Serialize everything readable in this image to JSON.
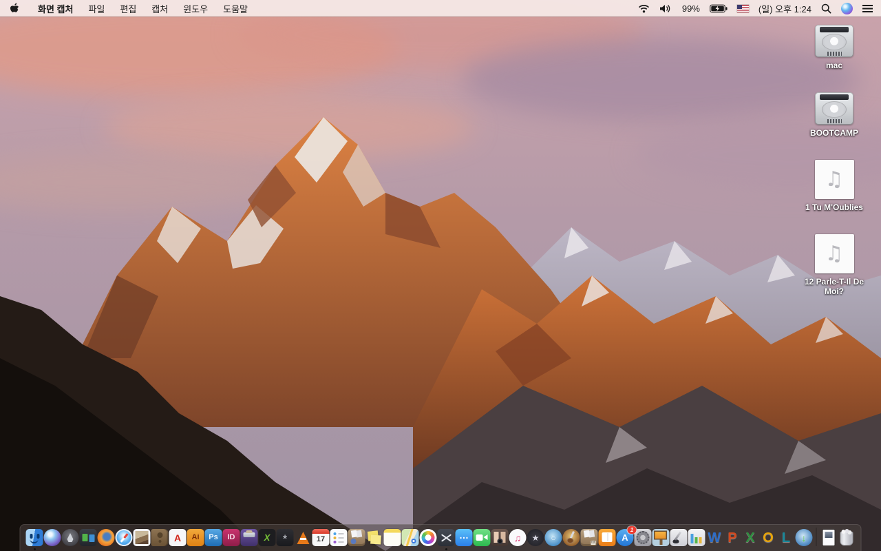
{
  "menu_bar": {
    "app_name": "화면 캡처",
    "menus": [
      "파일",
      "편집",
      "캡처",
      "윈도우",
      "도움말"
    ],
    "status": {
      "wifi_icon": "wifi-icon",
      "volume_icon": "volume-icon",
      "battery_percent": "99%",
      "battery_state": "charging",
      "input_source": "us-flag",
      "clock": "(일) 오후 1:24",
      "search_icon": "spotlight-search-icon",
      "siri_icon": "siri-icon",
      "notification_icon": "notification-center-icon"
    }
  },
  "desktop": {
    "icons": [
      {
        "name": "volume-mac",
        "kind": "harddrive",
        "label": "mac"
      },
      {
        "name": "volume-bootcamp",
        "kind": "harddrive",
        "label": "BOOTCAMP"
      },
      {
        "name": "audio-file-1",
        "kind": "audio",
        "label": "1 Tu M'Oublies"
      },
      {
        "name": "audio-file-2",
        "kind": "audio",
        "label": "12 Parle-T-Il De Moi?"
      }
    ]
  },
  "dock": {
    "items": [
      {
        "name": "finder",
        "kind": "finder",
        "running": true
      },
      {
        "name": "siri",
        "kind": "siri"
      },
      {
        "name": "launchpad",
        "kind": "launchpad"
      },
      {
        "name": "mission-control",
        "kind": "mc"
      },
      {
        "name": "firefox",
        "kind": "firefox"
      },
      {
        "name": "safari",
        "kind": "safari"
      },
      {
        "name": "preview",
        "kind": "preview"
      },
      {
        "name": "contacts",
        "kind": "contacts"
      },
      {
        "name": "acrobat-reader",
        "kind": "acrobat",
        "glyph": "A"
      },
      {
        "name": "illustrator",
        "kind": "ai",
        "glyph": "Ai"
      },
      {
        "name": "photoshop",
        "kind": "ps",
        "glyph": "Ps"
      },
      {
        "name": "indesign",
        "kind": "id",
        "glyph": "ID"
      },
      {
        "name": "toast-titanium",
        "kind": "toast"
      },
      {
        "name": "xee",
        "kind": "xee",
        "glyph": "X"
      },
      {
        "name": "fan-utility",
        "kind": "fan",
        "glyph": "*"
      },
      {
        "name": "vlc",
        "kind": "vlc"
      },
      {
        "name": "calendar",
        "kind": "calendar",
        "glyph": "17"
      },
      {
        "name": "reminders",
        "kind": "reminders"
      },
      {
        "name": "archive-box",
        "kind": "crate"
      },
      {
        "name": "stickies",
        "kind": "stickies"
      },
      {
        "name": "notes",
        "kind": "notes"
      },
      {
        "name": "maps",
        "kind": "maps"
      },
      {
        "name": "photos",
        "kind": "photos"
      },
      {
        "name": "screen-capture-grab",
        "kind": "grab",
        "running": true
      },
      {
        "name": "messages",
        "kind": "messages",
        "glyph": "…"
      },
      {
        "name": "facetime",
        "kind": "facetime"
      },
      {
        "name": "photo-booth",
        "kind": "photobooth"
      },
      {
        "name": "itunes",
        "kind": "itunes",
        "glyph": "♫"
      },
      {
        "name": "imovie",
        "kind": "imovie",
        "glyph": "★"
      },
      {
        "name": "idvd",
        "kind": "idvd",
        "glyph": "○"
      },
      {
        "name": "garageband",
        "kind": "garageband"
      },
      {
        "name": "unarchiver",
        "kind": "crate2"
      },
      {
        "name": "ibooks",
        "kind": "ibooks"
      },
      {
        "name": "app-store",
        "kind": "appstore",
        "glyph": "A",
        "badge": "1"
      },
      {
        "name": "system-preferences",
        "kind": "sysprefs"
      },
      {
        "name": "keynote",
        "kind": "keynote"
      },
      {
        "name": "pages",
        "kind": "pages"
      },
      {
        "name": "numbers",
        "kind": "numbers"
      },
      {
        "name": "word",
        "kind": "word",
        "glyph": "W"
      },
      {
        "name": "powerpoint",
        "kind": "powerpoint",
        "glyph": "P"
      },
      {
        "name": "excel",
        "kind": "excel",
        "glyph": "X"
      },
      {
        "name": "outlook",
        "kind": "outlook",
        "glyph": "O"
      },
      {
        "name": "lync",
        "kind": "lync",
        "glyph": "L"
      },
      {
        "name": "downloader",
        "kind": "downloader",
        "glyph": "↓"
      },
      {
        "name": "dock-divider",
        "kind": "divider"
      },
      {
        "name": "document-file",
        "kind": "docfile"
      },
      {
        "name": "trash-full",
        "kind": "trash"
      }
    ]
  },
  "colors": {
    "menubar_bg": "rgba(245,234,231,0.93)",
    "dock_bg": "rgba(74,66,64,0.55)",
    "badge_red": "#ec3b2f",
    "desktop_label": "#ffffff"
  }
}
